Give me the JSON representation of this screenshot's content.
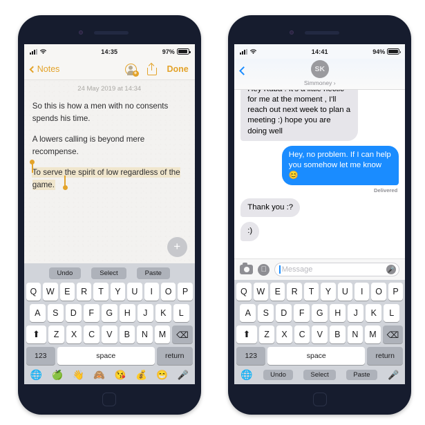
{
  "phones": {
    "left": {
      "status": {
        "time": "14:35",
        "battery": "97%",
        "signal_icon": "signal-bars-icon",
        "wifi_icon": "wifi-icon"
      },
      "nav": {
        "back_label": "Notes",
        "done_label": "Done",
        "add_user_icon": "add-person-icon",
        "share_icon": "share-icon",
        "accent": "#e3a32a"
      },
      "note": {
        "date": "24 May 2019 at 14:34",
        "paragraphs": [
          "So this is how a men with no consents spends his time.",
          "A lowers calling is beyond mere recompense."
        ],
        "selected_text": "To serve the spirit of low regardless of the game.",
        "selection_color": "#f0e6cd",
        "fab_label": "+"
      },
      "keyboard": {
        "assist": [
          "Undo",
          "Select",
          "Paste"
        ],
        "row1": [
          "Q",
          "W",
          "E",
          "R",
          "T",
          "Y",
          "U",
          "I",
          "O",
          "P"
        ],
        "row2": [
          "A",
          "S",
          "D",
          "F",
          "G",
          "H",
          "J",
          "K",
          "L"
        ],
        "row3": [
          "Z",
          "X",
          "C",
          "V",
          "B",
          "N",
          "M"
        ],
        "shift_label": "⬆",
        "backspace_label": "⌫",
        "num_label": "123",
        "space_label": "space",
        "return_label": "return",
        "bottom_icons": [
          "globe-icon",
          "apple-emoji",
          "waving-hand-emoji",
          "see-no-evil-monkey-emoji",
          "kissing-heart-emoji",
          "money-bag-emoji",
          "grinning-face-emoji",
          "microphone-icon"
        ],
        "bottom_glyphs": [
          "🌐",
          "🍏",
          "👋",
          "🙈",
          "😘",
          "💰",
          "😁",
          "🎤"
        ]
      }
    },
    "right": {
      "status": {
        "time": "14:41",
        "battery": "94%",
        "signal_icon": "signal-bars-icon",
        "wifi_icon": "wifi-icon"
      },
      "nav": {
        "back_icon": "back-chevron-icon",
        "avatar_initials": "SK",
        "contact_name": "Simmoney",
        "contact_chevron": "›"
      },
      "messages": [
        {
          "side": "in",
          "text": "Hey Kuba ! It's a little hectic for me at the moment , I'll reach out next week to plan a meeting :) hope you are doing well",
          "clipped": true
        },
        {
          "side": "out",
          "text": "Hey, no problem. If I can help you somehow let me know 😊",
          "status": "Delivered"
        },
        {
          "side": "in",
          "text": "Thank you :?"
        },
        {
          "side": "in",
          "text": ":)"
        }
      ],
      "composer": {
        "camera_icon": "camera-icon",
        "appstore_icon": "app-store-icon",
        "placeholder": "Message",
        "mic_icon": "microphone-icon"
      },
      "keyboard": {
        "row1": [
          "Q",
          "W",
          "E",
          "R",
          "T",
          "Y",
          "U",
          "I",
          "O",
          "P"
        ],
        "row2": [
          "A",
          "S",
          "D",
          "F",
          "G",
          "H",
          "J",
          "K",
          "L"
        ],
        "row3": [
          "Z",
          "X",
          "C",
          "V",
          "B",
          "N",
          "M"
        ],
        "shift_label": "⬆",
        "backspace_label": "⌫",
        "num_label": "123",
        "space_label": "space",
        "return_label": "return",
        "assist": [
          "Undo",
          "Select",
          "Paste"
        ],
        "globe_icon": "globe-icon",
        "mic_icon": "microphone-icon"
      }
    }
  }
}
